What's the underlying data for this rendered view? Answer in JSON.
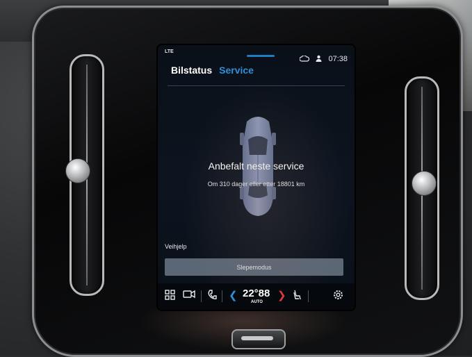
{
  "status_bar": {
    "network": "LTE",
    "time": "07:38",
    "icon_left": "cloud-sync-icon",
    "icon_right": "person-icon"
  },
  "tabs": [
    {
      "label": "Bilstatus",
      "active": false
    },
    {
      "label": "Service",
      "active": true
    }
  ],
  "service": {
    "title": "Anbefalt neste service",
    "subtitle": "Om 310 dager eller etter 18801 km"
  },
  "assistance": {
    "section_label": "Veihjelp",
    "tow_button_label": "Slepemodus"
  },
  "climate_dock": {
    "apps_icon": "grid-apps-icon",
    "camera_icon": "camera-icon",
    "phone_icon": "phone-icon",
    "temperature": "22°88",
    "temperature_mode": "AUTO",
    "seat_icon": "seat-heat-icon",
    "settings_icon": "gear-icon"
  },
  "colors": {
    "accent": "#2e8fd6",
    "temp_up": "#d93a3a",
    "button_bg": "#5b6774"
  }
}
